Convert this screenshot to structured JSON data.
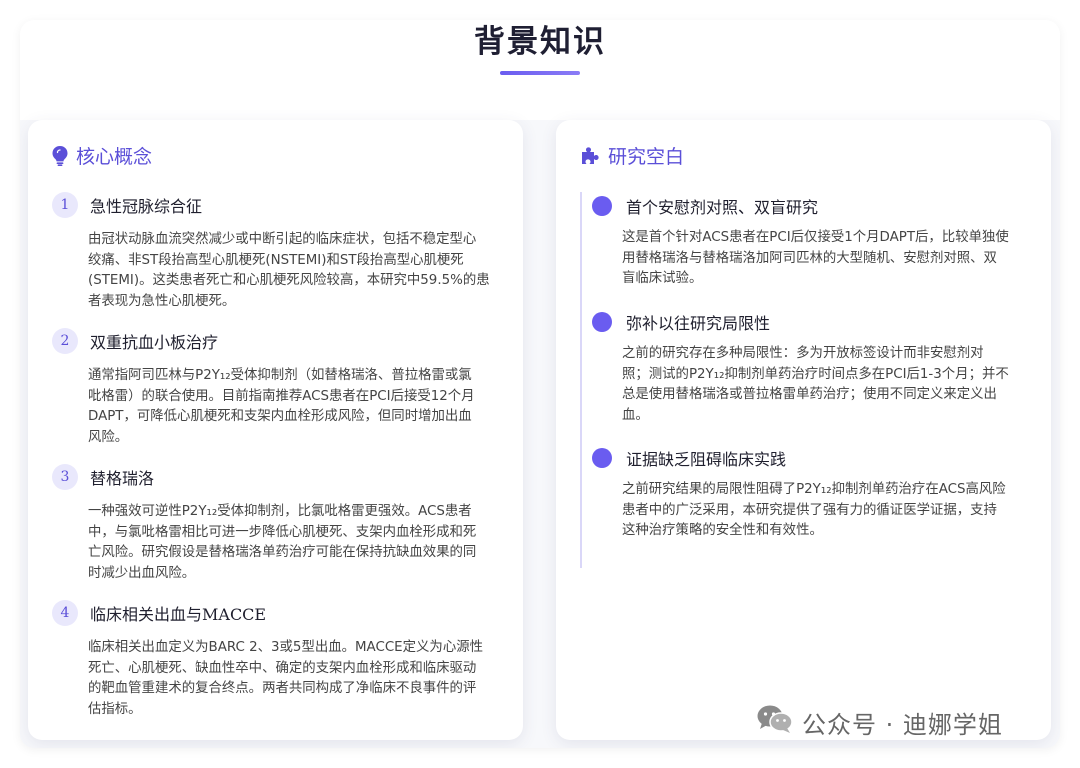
{
  "header": {
    "title": "背景知识"
  },
  "core_concepts": {
    "title": "核心概念",
    "icon": "lightbulb-icon",
    "items": [
      {
        "number": "1",
        "title": "急性冠脉综合征",
        "lines": [
          "由冠状动脉血流突然减少或中断引起的临床症状，包括不稳定型心",
          "绞痛、非ST段抬高型心肌梗死(NSTEMI)和ST段抬高型心肌梗死",
          "(STEMI)。这类患者死亡和心肌梗死风险较高，本研究中59.5%的患",
          "者表现为急性心肌梗死。"
        ]
      },
      {
        "number": "2",
        "title": "双重抗血小板治疗",
        "lines": [
          "通常指阿司匹林与P2Y₁₂受体抑制剂（如替格瑞洛、普拉格雷或氯",
          "吡格雷）的联合使用。目前指南推荐ACS患者在PCI后接受12个月",
          "DAPT，可降低心肌梗死和支架内血栓形成风险，但同时增加出血",
          "风险。"
        ]
      },
      {
        "number": "3",
        "title": "替格瑞洛",
        "lines": [
          "一种强效可逆性P2Y₁₂受体抑制剂，比氯吡格雷更强效。ACS患者",
          "中，与氯吡格雷相比可进一步降低心肌梗死、支架内血栓形成和死",
          "亡风险。研究假设是替格瑞洛单药治疗可能在保持抗缺血效果的同",
          "时减少出血风险。"
        ]
      },
      {
        "number": "4",
        "title": "临床相关出血与MACCE",
        "lines": [
          "临床相关出血定义为BARC 2、3或5型出血。MACCE定义为心源性",
          "死亡、心肌梗死、缺血性卒中、确定的支架内血栓形成和临床驱动",
          "的靶血管重建术的复合终点。两者共同构成了净临床不良事件的评",
          "估指标。"
        ]
      }
    ]
  },
  "research_gap": {
    "title": "研究空白",
    "icon": "puzzle-icon",
    "items": [
      {
        "title": "首个安慰剂对照、双盲研究",
        "lines": [
          "这是首个针对ACS患者在PCI后仅接受1个月DAPT后，比较单独使",
          "用替格瑞洛与替格瑞洛加阿司匹林的大型随机、安慰剂对照、双",
          "盲临床试验。"
        ]
      },
      {
        "title": "弥补以往研究局限性",
        "lines": [
          "之前的研究存在多种局限性：多为开放标签设计而非安慰剂对",
          "照；测试的P2Y₁₂抑制剂单药治疗时间点多在PCI后1-3个月；并不",
          "总是使用替格瑞洛或普拉格雷单药治疗；使用不同定义来定义出",
          "血。"
        ]
      },
      {
        "title": "证据缺乏阻碍临床实践",
        "lines": [
          "之前研究结果的局限性阻碍了P2Y₁₂抑制剂单药治疗在ACS高风险",
          "患者中的广泛采用，本研究提供了强有力的循证医学证据，支持",
          "这种治疗策略的安全性和有效性。"
        ]
      }
    ]
  },
  "watermark": {
    "text": "公众号 · 迪娜学姐",
    "icon": "wechat-icon"
  },
  "colors": {
    "accent": "#5b4fd8",
    "dot": "#6a5cf0",
    "badge_bg": "#e9e8fc"
  }
}
